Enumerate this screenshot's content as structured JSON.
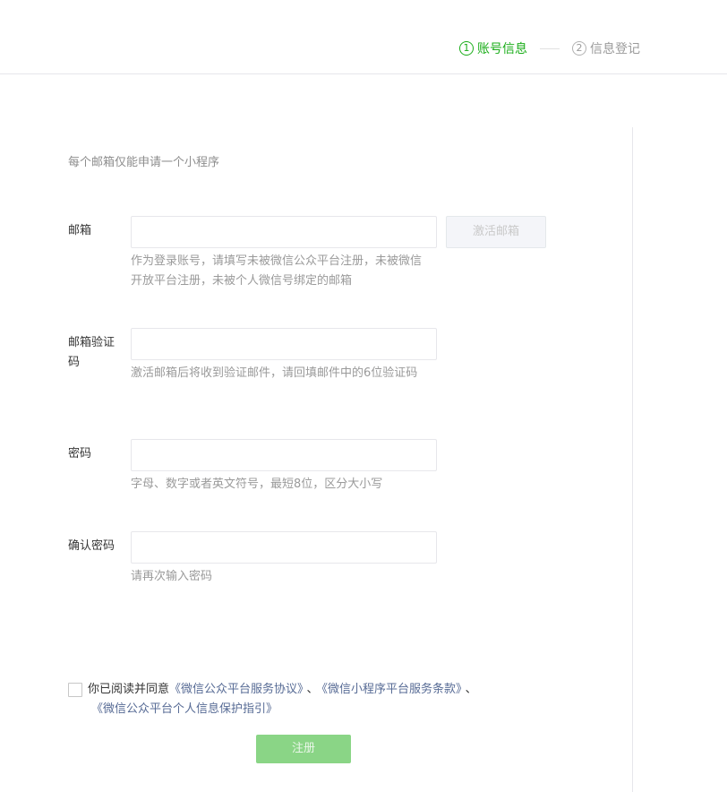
{
  "steps": [
    {
      "num": "1",
      "label": "账号信息",
      "active": true
    },
    {
      "num": "2",
      "label": "信息登记",
      "active": false
    }
  ],
  "form": {
    "tip": "每个邮箱仅能申请一个小程序",
    "email": {
      "label": "邮箱",
      "value": "",
      "placeholder": "",
      "hint": "作为登录账号，请填写未被微信公众平台注册，未被微信开放平台注册，未被个人微信号绑定的邮箱",
      "activate_label": "激活邮箱"
    },
    "code": {
      "label": "邮箱验证码",
      "value": "",
      "placeholder": "",
      "hint": "激活邮箱后将收到验证邮件，请回填邮件中的6位验证码"
    },
    "password": {
      "label": "密码",
      "value": "",
      "placeholder": "",
      "hint": "字母、数字或者英文符号，最短8位，区分大小写"
    },
    "confirm": {
      "label": "确认密码",
      "value": "",
      "placeholder": "",
      "hint": "请再次输入密码"
    }
  },
  "agreement": {
    "checked": false,
    "prefix": "你已阅读并同意",
    "link1": "《微信公众平台服务协议》",
    "sep1": "、",
    "link2": "《微信小程序平台服务条款》",
    "sep2": "、",
    "link3": "《微信公众平台个人信息保护指引》"
  },
  "register_label": "注册",
  "colors": {
    "accent": "#1aad19",
    "link": "#576b95",
    "button_disabled": "#8ad586"
  }
}
